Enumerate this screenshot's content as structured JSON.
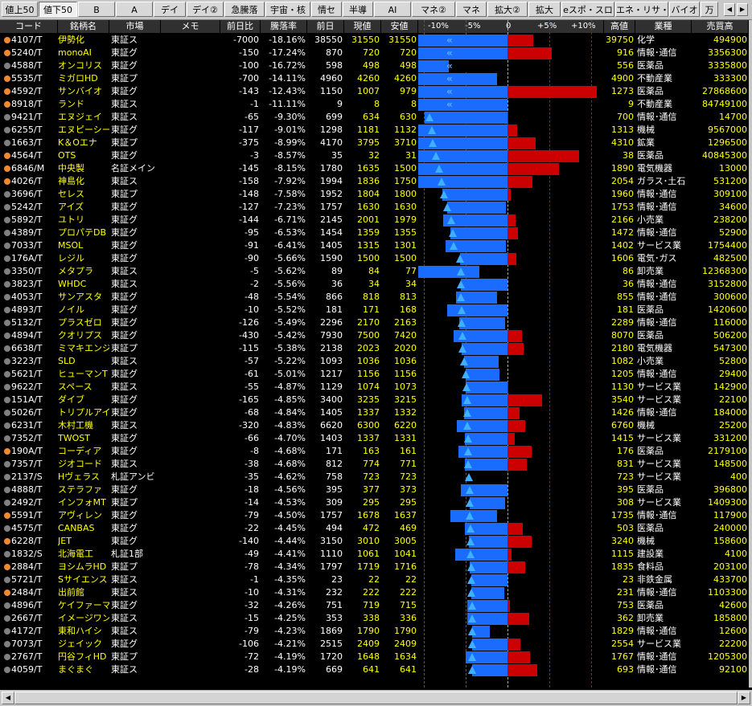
{
  "tabs": [
    {
      "label": "値上50",
      "active": false
    },
    {
      "label": "値下50",
      "active": true
    },
    {
      "label": "B",
      "active": false
    },
    {
      "label": "A",
      "active": false
    },
    {
      "label": "デイ",
      "active": false
    },
    {
      "label": "デイ②",
      "active": false
    },
    {
      "label": "急騰落",
      "active": false
    },
    {
      "label": "宇宙・核",
      "active": false
    },
    {
      "label": "情セ",
      "active": false
    },
    {
      "label": "半導",
      "active": false
    },
    {
      "label": "AI",
      "active": false
    },
    {
      "label": "マネ②",
      "active": false
    },
    {
      "label": "マネ",
      "active": false
    },
    {
      "label": "拡大②",
      "active": false
    },
    {
      "label": "拡大",
      "active": false
    },
    {
      "label": "eスポ・スロ",
      "active": false
    },
    {
      "label": "エネ・リサ・スロ",
      "active": false
    },
    {
      "label": "バイオ",
      "active": false
    },
    {
      "label": "万",
      "active": false
    }
  ],
  "columns": {
    "code": "コード",
    "name": "銘柄名",
    "market": "市場",
    "memo": "メモ",
    "diff": "前日比",
    "pct": "騰落率",
    "prev": "前日",
    "price": "現値",
    "low": "安値",
    "scale": [
      "-10%",
      "-5%",
      "0",
      "+5%",
      "+10%"
    ],
    "high": "高値",
    "industry": "業種",
    "volume": "売買高"
  },
  "colors": {
    "orange_dot": "#f08a30",
    "gray_dot": "#808080",
    "blue_bar": "#1a6cff",
    "red_bar": "#cc0000",
    "name_yellow": "#ffff00"
  },
  "rows": [
    {
      "dot": "orange",
      "code": "4107/T",
      "name": "伊勢化",
      "market": "東証ス",
      "diff": "-7000",
      "pct": "-18.16%",
      "prev": "38550",
      "price": "31550",
      "low": "31550",
      "high": "39750",
      "industry": "化学",
      "volume": "494900",
      "pctv": -18.16,
      "lowpct": -18.16,
      "highpct": 3.11
    },
    {
      "dot": "orange",
      "code": "5240/T",
      "name": "monoAI",
      "market": "東証グ",
      "diff": "-150",
      "pct": "-17.24%",
      "prev": "870",
      "price": "720",
      "low": "720",
      "high": "916",
      "industry": "情報･通信",
      "volume": "3356300",
      "pctv": -17.24,
      "lowpct": -17.24,
      "highpct": 5.29
    },
    {
      "dot": "gray",
      "code": "4588/T",
      "name": "オンコリス",
      "market": "東証グ",
      "diff": "-100",
      "pct": "-16.72%",
      "prev": "598",
      "price": "498",
      "low": "498",
      "high": "556",
      "industry": "医薬品",
      "volume": "3335800",
      "pctv": -16.72,
      "lowpct": -16.72,
      "highpct": -7.02
    },
    {
      "dot": "orange",
      "code": "5535/T",
      "name": "ミガロHD",
      "market": "東証プ",
      "diff": "-700",
      "pct": "-14.11%",
      "prev": "4960",
      "price": "4260",
      "low": "4260",
      "high": "4900",
      "industry": "不動産業",
      "volume": "333300",
      "pctv": -14.11,
      "lowpct": -14.11,
      "highpct": -1.21
    },
    {
      "dot": "orange",
      "code": "4592/T",
      "name": "サンバイオ",
      "market": "東証グ",
      "diff": "-143",
      "pct": "-12.43%",
      "prev": "1150",
      "price": "1007",
      "low": "979",
      "high": "1273",
      "industry": "医薬品",
      "volume": "27868600",
      "pctv": -12.43,
      "lowpct": -14.87,
      "highpct": 10.7
    },
    {
      "dot": "orange",
      "code": "8918/T",
      "name": "ランド",
      "market": "東証ス",
      "diff": "-1",
      "pct": "-11.11%",
      "prev": "9",
      "price": "8",
      "low": "8",
      "high": "9",
      "industry": "不動産業",
      "volume": "84749100",
      "pctv": -11.11,
      "lowpct": -11.11,
      "highpct": 0
    },
    {
      "dot": "gray",
      "code": "9421/T",
      "name": "エヌジェイ",
      "market": "東証ス",
      "diff": "-65",
      "pct": "-9.30%",
      "prev": "699",
      "price": "634",
      "low": "630",
      "high": "700",
      "industry": "情報･通信",
      "volume": "14700",
      "pctv": -9.3,
      "lowpct": -9.87,
      "highpct": 0.14
    },
    {
      "dot": "gray",
      "code": "6255/T",
      "name": "エヌピーシー",
      "market": "東証グ",
      "diff": "-117",
      "pct": "-9.01%",
      "prev": "1298",
      "price": "1181",
      "low": "1132",
      "high": "1313",
      "industry": "機械",
      "volume": "9567000",
      "pctv": -9.01,
      "lowpct": -12.79,
      "highpct": 1.16
    },
    {
      "dot": "gray",
      "code": "1663/T",
      "name": "K＆Oエナ",
      "market": "東証プ",
      "diff": "-375",
      "pct": "-8.99%",
      "prev": "4170",
      "price": "3795",
      "low": "3710",
      "high": "4310",
      "industry": "鉱業",
      "volume": "1296500",
      "pctv": -8.99,
      "lowpct": -11.03,
      "highpct": 3.36
    },
    {
      "dot": "orange",
      "code": "4564/T",
      "name": "OTS",
      "market": "東証グ",
      "diff": "-3",
      "pct": "-8.57%",
      "prev": "35",
      "price": "32",
      "low": "31",
      "high": "38",
      "industry": "医薬品",
      "volume": "40845300",
      "pctv": -8.57,
      "lowpct": -11.43,
      "highpct": 8.57
    },
    {
      "dot": "orange",
      "code": "6846/M",
      "name": "中央製",
      "market": "名証メイン",
      "diff": "-145",
      "pct": "-8.15%",
      "prev": "1780",
      "price": "1635",
      "low": "1500",
      "high": "1890",
      "industry": "電気機器",
      "volume": "13000",
      "pctv": -8.15,
      "lowpct": -15.73,
      "highpct": 6.18
    },
    {
      "dot": "orange",
      "code": "4026/T",
      "name": "神島化",
      "market": "東証ス",
      "diff": "-158",
      "pct": "-7.92%",
      "prev": "1994",
      "price": "1836",
      "low": "1750",
      "high": "2054",
      "industry": "ガラス･土石",
      "volume": "531200",
      "pctv": -7.92,
      "lowpct": -12.24,
      "highpct": 3.01
    },
    {
      "dot": "gray",
      "code": "3696/T",
      "name": "セレス",
      "market": "東証プ",
      "diff": "-148",
      "pct": "-7.58%",
      "prev": "1952",
      "price": "1804",
      "low": "1800",
      "high": "1960",
      "industry": "情報･通信",
      "volume": "309100",
      "pctv": -7.58,
      "lowpct": -7.79,
      "highpct": 0.41
    },
    {
      "dot": "gray",
      "code": "5242/T",
      "name": "アイズ",
      "market": "東証グ",
      "diff": "-127",
      "pct": "-7.23%",
      "prev": "1757",
      "price": "1630",
      "low": "1630",
      "high": "1753",
      "industry": "情報･通信",
      "volume": "34600",
      "pctv": -7.23,
      "lowpct": -7.23,
      "highpct": -0.23
    },
    {
      "dot": "gray",
      "code": "5892/T",
      "name": "ユトリ",
      "market": "東証グ",
      "diff": "-144",
      "pct": "-6.71%",
      "prev": "2145",
      "price": "2001",
      "low": "1979",
      "high": "2166",
      "industry": "小売業",
      "volume": "238200",
      "pctv": -6.71,
      "lowpct": -7.74,
      "highpct": 0.98
    },
    {
      "dot": "gray",
      "code": "4389/T",
      "name": "プロパテDB",
      "market": "東証グ",
      "diff": "-95",
      "pct": "-6.53%",
      "prev": "1454",
      "price": "1359",
      "low": "1355",
      "high": "1472",
      "industry": "情報･通信",
      "volume": "52900",
      "pctv": -6.53,
      "lowpct": -6.81,
      "highpct": 1.24
    },
    {
      "dot": "gray",
      "code": "7033/T",
      "name": "MSOL",
      "market": "東証グ",
      "diff": "-91",
      "pct": "-6.41%",
      "prev": "1405",
      "price": "1315",
      "low": "1301",
      "high": "1402",
      "industry": "サービス業",
      "volume": "1754400",
      "pctv": -6.41,
      "lowpct": -7.4,
      "highpct": -0.21
    },
    {
      "dot": "gray",
      "code": "176A/T",
      "name": "レジル",
      "market": "東証グ",
      "diff": "-90",
      "pct": "-5.66%",
      "prev": "1590",
      "price": "1500",
      "low": "1500",
      "high": "1606",
      "industry": "電気･ガス",
      "volume": "482500",
      "pctv": -5.66,
      "lowpct": -5.66,
      "highpct": 1.01
    },
    {
      "dot": "gray",
      "code": "3350/T",
      "name": "メタプラ",
      "market": "東証ス",
      "diff": "-5",
      "pct": "-5.62%",
      "prev": "89",
      "price": "84",
      "low": "77",
      "high": "86",
      "industry": "卸売業",
      "volume": "12368300",
      "pctv": -5.62,
      "lowpct": -13.48,
      "highpct": -3.37
    },
    {
      "dot": "gray",
      "code": "3823/T",
      "name": "WHDC",
      "market": "東証ス",
      "diff": "-2",
      "pct": "-5.56%",
      "prev": "36",
      "price": "34",
      "low": "34",
      "high": "36",
      "industry": "情報･通信",
      "volume": "3152800",
      "pctv": -5.56,
      "lowpct": -5.56,
      "highpct": 0
    },
    {
      "dot": "gray",
      "code": "4053/T",
      "name": "サンアスタ",
      "market": "東証グ",
      "diff": "-48",
      "pct": "-5.54%",
      "prev": "866",
      "price": "818",
      "low": "813",
      "high": "855",
      "industry": "情報･通信",
      "volume": "300600",
      "pctv": -5.54,
      "lowpct": -6.12,
      "highpct": -1.27
    },
    {
      "dot": "gray",
      "code": "4893/T",
      "name": "ノイル",
      "market": "東証グ",
      "diff": "-10",
      "pct": "-5.52%",
      "prev": "181",
      "price": "171",
      "low": "168",
      "high": "181",
      "industry": "医薬品",
      "volume": "1420600",
      "pctv": -5.52,
      "lowpct": -7.18,
      "highpct": 0
    },
    {
      "dot": "gray",
      "code": "5132/T",
      "name": "プラスゼロ",
      "market": "東証グ",
      "diff": "-126",
      "pct": "-5.49%",
      "prev": "2296",
      "price": "2170",
      "low": "2163",
      "high": "2289",
      "industry": "情報･通信",
      "volume": "116000",
      "pctv": -5.49,
      "lowpct": -5.79,
      "highpct": -0.3
    },
    {
      "dot": "gray",
      "code": "4894/T",
      "name": "クオリプス",
      "market": "東証グ",
      "diff": "-430",
      "pct": "-5.42%",
      "prev": "7930",
      "price": "7500",
      "low": "7420",
      "high": "8070",
      "industry": "医薬品",
      "volume": "506200",
      "pctv": -5.42,
      "lowpct": -6.43,
      "highpct": 1.77
    },
    {
      "dot": "gray",
      "code": "6638/T",
      "name": "ミマキエンジ",
      "market": "東証プ",
      "diff": "-115",
      "pct": "-5.38%",
      "prev": "2138",
      "price": "2023",
      "low": "2020",
      "high": "2180",
      "industry": "電気機器",
      "volume": "547300",
      "pctv": -5.38,
      "lowpct": -5.52,
      "highpct": 1.96
    },
    {
      "dot": "gray",
      "code": "3223/T",
      "name": "SLD",
      "market": "東証ス",
      "diff": "-57",
      "pct": "-5.22%",
      "prev": "1093",
      "price": "1036",
      "low": "1036",
      "high": "1082",
      "industry": "小売業",
      "volume": "52800",
      "pctv": -5.22,
      "lowpct": -5.22,
      "highpct": -1.01
    },
    {
      "dot": "gray",
      "code": "5621/T",
      "name": "ヒューマンT",
      "market": "東証グ",
      "diff": "-61",
      "pct": "-5.01%",
      "prev": "1217",
      "price": "1156",
      "low": "1156",
      "high": "1205",
      "industry": "情報･通信",
      "volume": "29400",
      "pctv": -5.01,
      "lowpct": -5.01,
      "highpct": -0.99
    },
    {
      "dot": "gray",
      "code": "9622/T",
      "name": "スペース",
      "market": "東証ス",
      "diff": "-55",
      "pct": "-4.87%",
      "prev": "1129",
      "price": "1074",
      "low": "1073",
      "high": "1130",
      "industry": "サービス業",
      "volume": "142900",
      "pctv": -4.87,
      "lowpct": -4.96,
      "highpct": 0.09
    },
    {
      "dot": "gray",
      "code": "151A/T",
      "name": "ダイブ",
      "market": "東証グ",
      "diff": "-165",
      "pct": "-4.85%",
      "prev": "3400",
      "price": "3235",
      "low": "3215",
      "high": "3540",
      "industry": "サービス業",
      "volume": "22100",
      "pctv": -4.85,
      "lowpct": -5.44,
      "highpct": 4.12
    },
    {
      "dot": "gray",
      "code": "5026/T",
      "name": "トリプルアイ",
      "market": "東証グ",
      "diff": "-68",
      "pct": "-4.84%",
      "prev": "1405",
      "price": "1337",
      "low": "1332",
      "high": "1426",
      "industry": "情報･通信",
      "volume": "184000",
      "pctv": -4.84,
      "lowpct": -5.2,
      "highpct": 1.49
    },
    {
      "dot": "gray",
      "code": "6231/T",
      "name": "木村工機",
      "market": "東証ス",
      "diff": "-320",
      "pct": "-4.83%",
      "prev": "6620",
      "price": "6300",
      "low": "6220",
      "high": "6760",
      "industry": "機械",
      "volume": "25200",
      "pctv": -4.83,
      "lowpct": -6.04,
      "highpct": 2.11
    },
    {
      "dot": "gray",
      "code": "7352/T",
      "name": "TWOST",
      "market": "東証グ",
      "diff": "-66",
      "pct": "-4.70%",
      "prev": "1403",
      "price": "1337",
      "low": "1331",
      "high": "1415",
      "industry": "サービス業",
      "volume": "331200",
      "pctv": -4.7,
      "lowpct": -5.13,
      "highpct": 0.86
    },
    {
      "dot": "orange",
      "code": "190A/T",
      "name": "コーディア",
      "market": "東証グ",
      "diff": "-8",
      "pct": "-4.68%",
      "prev": "171",
      "price": "163",
      "low": "161",
      "high": "176",
      "industry": "医薬品",
      "volume": "2179100",
      "pctv": -4.68,
      "lowpct": -5.85,
      "highpct": 2.92
    },
    {
      "dot": "gray",
      "code": "7357/T",
      "name": "ジオコード",
      "market": "東証ス",
      "diff": "-38",
      "pct": "-4.68%",
      "prev": "812",
      "price": "774",
      "low": "771",
      "high": "831",
      "industry": "サービス業",
      "volume": "148500",
      "pctv": -4.68,
      "lowpct": -5.05,
      "highpct": 2.34
    },
    {
      "dot": "gray",
      "code": "2137/S",
      "name": "Hヴェラス",
      "market": "札証アンビ",
      "diff": "-35",
      "pct": "-4.62%",
      "prev": "758",
      "price": "723",
      "low": "723",
      "high": "723",
      "industry": "サービス業",
      "volume": "400",
      "pctv": -4.62,
      "lowpct": -4.62,
      "highpct": -4.62
    },
    {
      "dot": "gray",
      "code": "4888/T",
      "name": "ステラファ",
      "market": "東証グ",
      "diff": "-18",
      "pct": "-4.56%",
      "prev": "395",
      "price": "377",
      "low": "373",
      "high": "395",
      "industry": "医薬品",
      "volume": "396800",
      "pctv": -4.56,
      "lowpct": -5.57,
      "highpct": 0
    },
    {
      "dot": "gray",
      "code": "2492/T",
      "name": "インフォMT",
      "market": "東証プ",
      "diff": "-14",
      "pct": "-4.53%",
      "prev": "309",
      "price": "295",
      "low": "295",
      "high": "308",
      "industry": "サービス業",
      "volume": "1409300",
      "pctv": -4.53,
      "lowpct": -4.53,
      "highpct": -0.32
    },
    {
      "dot": "orange",
      "code": "5591/T",
      "name": "アヴィレン",
      "market": "東証グ",
      "diff": "-79",
      "pct": "-4.50%",
      "prev": "1757",
      "price": "1678",
      "low": "1637",
      "high": "1735",
      "industry": "情報･通信",
      "volume": "117900",
      "pctv": -4.5,
      "lowpct": -6.83,
      "highpct": -1.25
    },
    {
      "dot": "gray",
      "code": "4575/T",
      "name": "CANBAS",
      "market": "東証グ",
      "diff": "-22",
      "pct": "-4.45%",
      "prev": "494",
      "price": "472",
      "low": "469",
      "high": "503",
      "industry": "医薬品",
      "volume": "240000",
      "pctv": -4.45,
      "lowpct": -5.06,
      "highpct": 1.82
    },
    {
      "dot": "orange",
      "code": "6228/T",
      "name": "JET",
      "market": "東証グ",
      "diff": "-140",
      "pct": "-4.44%",
      "prev": "3150",
      "price": "3010",
      "low": "3005",
      "high": "3240",
      "industry": "機械",
      "volume": "158600",
      "pctv": -4.44,
      "lowpct": -4.6,
      "highpct": 2.86
    },
    {
      "dot": "gray",
      "code": "1832/S",
      "name": "北海電工",
      "market": "札証1部",
      "diff": "-49",
      "pct": "-4.41%",
      "prev": "1110",
      "price": "1061",
      "low": "1041",
      "high": "1115",
      "industry": "建設業",
      "volume": "4100",
      "pctv": -4.41,
      "lowpct": -6.22,
      "highpct": 0.45
    },
    {
      "dot": "orange",
      "code": "2884/T",
      "name": "ヨシムラHD",
      "market": "東証プ",
      "diff": "-78",
      "pct": "-4.34%",
      "prev": "1797",
      "price": "1719",
      "low": "1716",
      "high": "1835",
      "industry": "食料品",
      "volume": "203100",
      "pctv": -4.34,
      "lowpct": -4.51,
      "highpct": 2.11
    },
    {
      "dot": "gray",
      "code": "5721/T",
      "name": "Sサイエンス",
      "market": "東証ス",
      "diff": "-1",
      "pct": "-4.35%",
      "prev": "23",
      "price": "22",
      "low": "22",
      "high": "23",
      "industry": "非鉄金属",
      "volume": "433700",
      "pctv": -4.35,
      "lowpct": -4.35,
      "highpct": 0
    },
    {
      "dot": "orange",
      "code": "2484/T",
      "name": "出前館",
      "market": "東証ス",
      "diff": "-10",
      "pct": "-4.31%",
      "prev": "232",
      "price": "222",
      "low": "222",
      "high": "231",
      "industry": "情報･通信",
      "volume": "1103300",
      "pctv": -4.31,
      "lowpct": -4.31,
      "highpct": -0.43
    },
    {
      "dot": "gray",
      "code": "4896/T",
      "name": "ケイファーマ",
      "market": "東証グ",
      "diff": "-32",
      "pct": "-4.26%",
      "prev": "751",
      "price": "719",
      "low": "715",
      "high": "753",
      "industry": "医薬品",
      "volume": "42600",
      "pctv": -4.26,
      "lowpct": -4.79,
      "highpct": 0.27
    },
    {
      "dot": "gray",
      "code": "2667/T",
      "name": "イメージワン",
      "market": "東証ス",
      "diff": "-15",
      "pct": "-4.25%",
      "prev": "353",
      "price": "338",
      "low": "336",
      "high": "362",
      "industry": "卸売業",
      "volume": "185800",
      "pctv": -4.25,
      "lowpct": -4.82,
      "highpct": 2.55
    },
    {
      "dot": "gray",
      "code": "4172/T",
      "name": "東和ハイシ",
      "market": "東証ス",
      "diff": "-79",
      "pct": "-4.23%",
      "prev": "1869",
      "price": "1790",
      "low": "1790",
      "high": "1829",
      "industry": "情報･通信",
      "volume": "12600",
      "pctv": -4.23,
      "lowpct": -4.23,
      "highpct": -2.14
    },
    {
      "dot": "gray",
      "code": "7073/T",
      "name": "ジェイック",
      "market": "東証グ",
      "diff": "-106",
      "pct": "-4.21%",
      "prev": "2515",
      "price": "2409",
      "low": "2409",
      "high": "2554",
      "industry": "サービス業",
      "volume": "22200",
      "pctv": -4.21,
      "lowpct": -4.21,
      "highpct": 1.55
    },
    {
      "dot": "gray",
      "code": "2767/T",
      "name": "円谷フィHD",
      "market": "東証プ",
      "diff": "-72",
      "pct": "-4.19%",
      "prev": "1720",
      "price": "1648",
      "low": "1634",
      "high": "1767",
      "industry": "情報･通信",
      "volume": "1205300",
      "pctv": -4.19,
      "lowpct": -5.0,
      "highpct": 2.73
    },
    {
      "dot": "gray",
      "code": "4059/T",
      "name": "まぐまぐ",
      "market": "東証ス",
      "diff": "-28",
      "pct": "-4.19%",
      "prev": "669",
      "price": "641",
      "low": "641",
      "high": "693",
      "industry": "情報･通信",
      "volume": "92100",
      "pctv": -4.19,
      "lowpct": -4.19,
      "highpct": 3.59
    }
  ]
}
